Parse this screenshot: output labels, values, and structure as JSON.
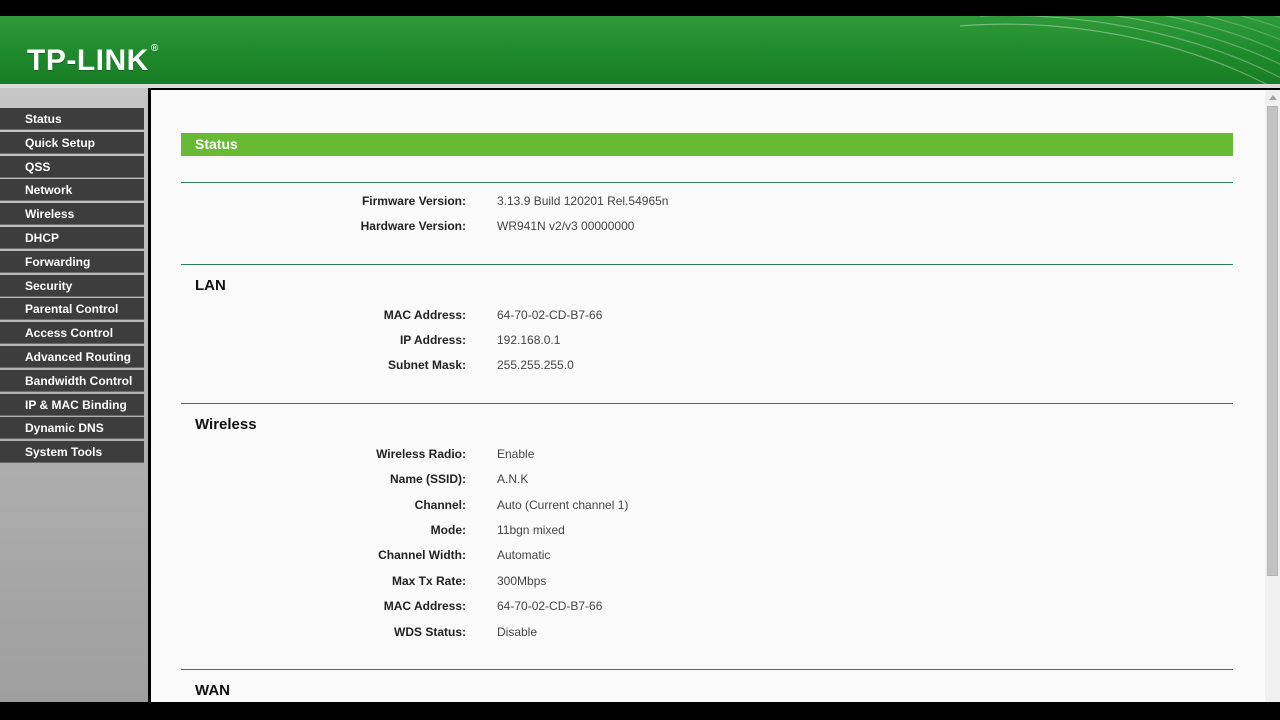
{
  "brand": {
    "logo": "TP-LINK",
    "trademark": "®",
    "accent": "#66bb33",
    "header_color": "#1f8a2c"
  },
  "menu": [
    {
      "label": "Status"
    },
    {
      "label": "Quick Setup"
    },
    {
      "label": "QSS"
    },
    {
      "label": "Network"
    },
    {
      "label": "Wireless"
    },
    {
      "label": "DHCP"
    },
    {
      "label": "Forwarding"
    },
    {
      "label": "Security"
    },
    {
      "label": "Parental Control"
    },
    {
      "label": "Access Control"
    },
    {
      "label": "Advanced Routing"
    },
    {
      "label": "Bandwidth Control"
    },
    {
      "label": "IP & MAC Binding"
    },
    {
      "label": "Dynamic DNS"
    },
    {
      "label": "System Tools"
    }
  ],
  "page": {
    "title": "Status",
    "general": [
      {
        "label": "Firmware Version:",
        "value": "3.13.9 Build 120201 Rel.54965n"
      },
      {
        "label": "Hardware Version:",
        "value": "WR941N v2/v3 00000000"
      }
    ],
    "lan": {
      "heading": "LAN",
      "rows": [
        {
          "label": "MAC Address:",
          "value": "64-70-02-CD-B7-66"
        },
        {
          "label": "IP Address:",
          "value": "192.168.0.1"
        },
        {
          "label": "Subnet Mask:",
          "value": "255.255.255.0"
        }
      ]
    },
    "wireless": {
      "heading": "Wireless",
      "rows": [
        {
          "label": "Wireless Radio:",
          "value": "Enable"
        },
        {
          "label": "Name (SSID):",
          "value": "A.N.K"
        },
        {
          "label": "Channel:",
          "value": "Auto (Current channel 1)"
        },
        {
          "label": "Mode:",
          "value": "11bgn mixed"
        },
        {
          "label": "Channel Width:",
          "value": "Automatic"
        },
        {
          "label": "Max Tx Rate:",
          "value": "300Mbps"
        },
        {
          "label": "MAC Address:",
          "value": "64-70-02-CD-B7-66"
        },
        {
          "label": "WDS Status:",
          "value": "Disable"
        }
      ]
    },
    "wan": {
      "heading": "WAN"
    }
  }
}
